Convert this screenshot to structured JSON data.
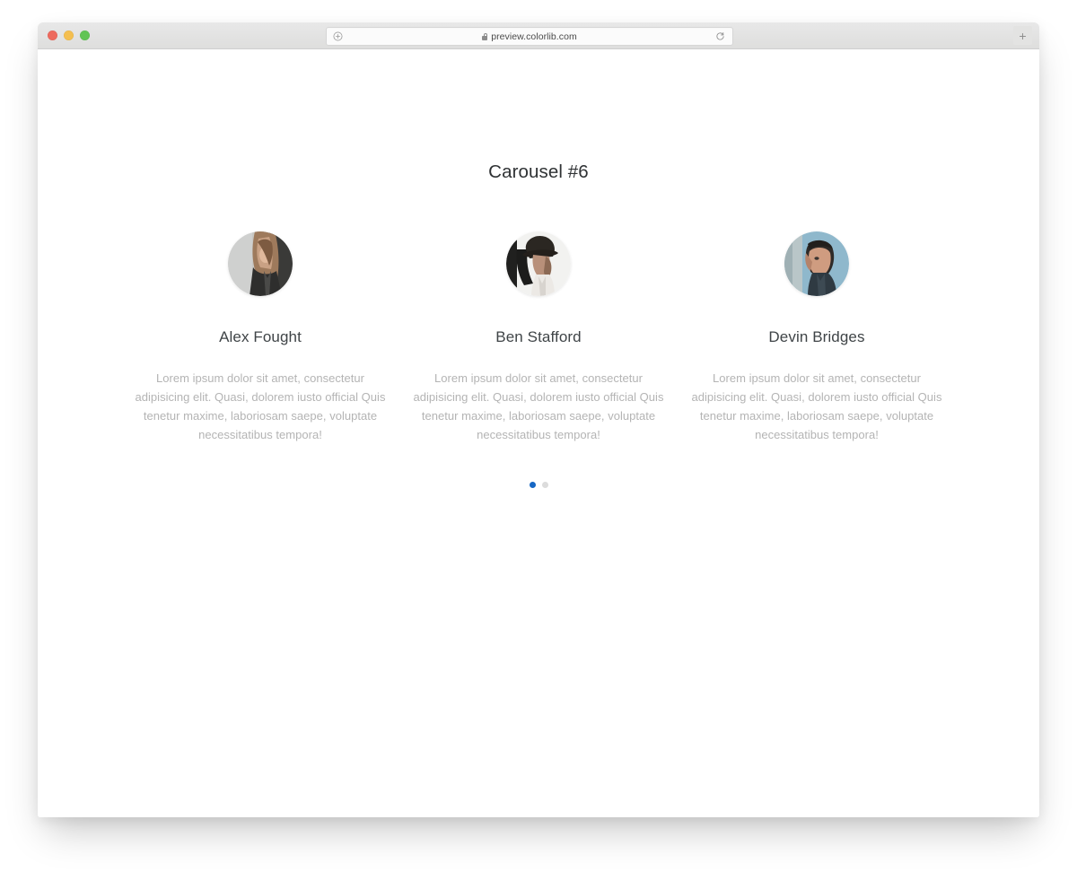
{
  "browser": {
    "traffic_lights": [
      {
        "name": "close",
        "color": "#ed6a5e"
      },
      {
        "name": "minimize",
        "color": "#f4bf50"
      },
      {
        "name": "maximize",
        "color": "#61c454"
      }
    ],
    "address_bar": {
      "url": "preview.colorlib.com",
      "lock_icon": "lock-icon",
      "left_icon": "circle-plus-icon",
      "reload_icon": "reload-icon"
    },
    "new_tab_label": "+"
  },
  "page": {
    "title": "Carousel #6",
    "slides": [
      {
        "name": "Alex Fought",
        "text": "Lorem ipsum dolor sit amet, consectetur adipisicing elit. Quasi, dolorem iusto official Quis tenetur maxime, laboriosam saepe, voluptate necessitatibus tempora!",
        "avatar": "avatar-alex-fought"
      },
      {
        "name": "Ben Stafford",
        "text": "Lorem ipsum dolor sit amet, consectetur adipisicing elit. Quasi, dolorem iusto official Quis tenetur maxime, laboriosam saepe, voluptate necessitatibus tempora!",
        "avatar": "avatar-ben-stafford"
      },
      {
        "name": "Devin Bridges",
        "text": "Lorem ipsum dolor sit amet, consectetur adipisicing elit. Quasi, dolorem iusto official Quis tenetur maxime, laboriosam saepe, voluptate necessitatibus tempora!",
        "avatar": "avatar-devin-bridges"
      }
    ],
    "pagination": {
      "dots": [
        {
          "active": true,
          "color": "#1667c4"
        },
        {
          "active": false,
          "color": "#dcdcdc"
        }
      ]
    }
  },
  "colors": {
    "accent": "#1667c4",
    "title_text": "#2f3234",
    "name_text": "#3f4447",
    "body_text": "#b4b4b4",
    "page_background": "#ffffff"
  }
}
